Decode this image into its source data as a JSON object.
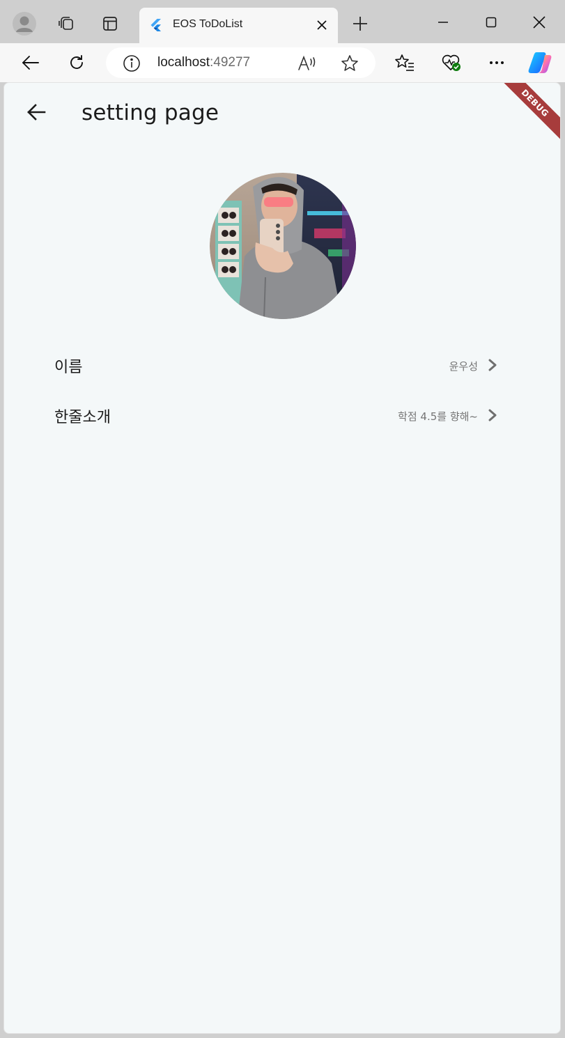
{
  "browser": {
    "tab": {
      "title": "EOS ToDoList",
      "favicon": "flutter-icon"
    },
    "address": {
      "host": "localhost",
      "port": ":49277"
    },
    "icons": [
      "profile-icon",
      "workspaces-icon",
      "tab-actions-icon",
      "new-tab-icon",
      "minimize-icon",
      "maximize-icon",
      "close-icon",
      "back-icon",
      "refresh-icon",
      "site-info-icon",
      "read-aloud-icon",
      "favorite-star-icon",
      "favorites-list-icon",
      "browser-essentials-icon",
      "more-menu-icon",
      "copilot-icon"
    ]
  },
  "app": {
    "title": "setting page",
    "debug_banner": "DEBUG",
    "settings": [
      {
        "label": "이름",
        "value": "윤우성"
      },
      {
        "label": "한줄소개",
        "value": "학점 4.5를 향해~"
      }
    ]
  },
  "colors": {
    "page_bg": "#f4f8f9",
    "debug_ribbon": "#a73c3c",
    "value_text": "#757575"
  }
}
